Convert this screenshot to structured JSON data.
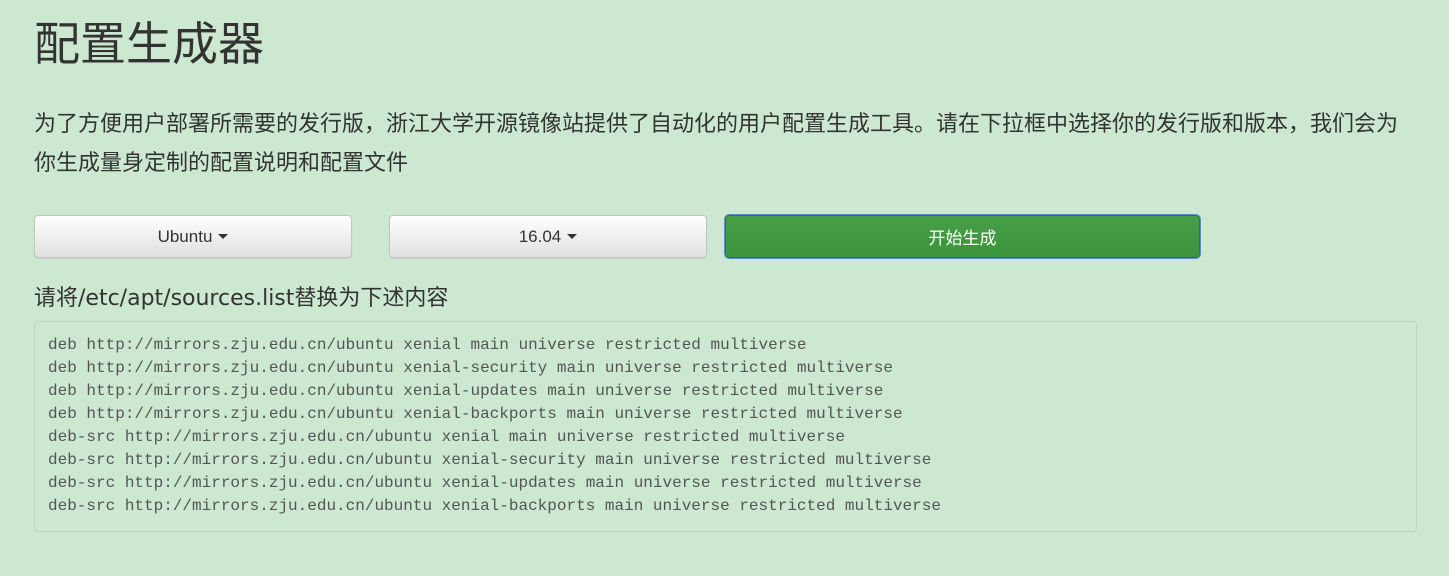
{
  "page": {
    "title": "配置生成器",
    "description": "为了方便用户部署所需要的发行版，浙江大学开源镜像站提供了自动化的用户配置生成工具。请在下拉框中选择你的发行版和版本，我们会为你生成量身定制的配置说明和配置文件"
  },
  "controls": {
    "distro_selected": "Ubuntu",
    "version_selected": "16.04",
    "generate_label": "开始生成"
  },
  "result": {
    "label": "请将/etc/apt/sources.list替换为下述内容",
    "lines": [
      "deb http://mirrors.zju.edu.cn/ubuntu xenial main universe restricted multiverse",
      "deb http://mirrors.zju.edu.cn/ubuntu xenial-security main universe restricted multiverse",
      "deb http://mirrors.zju.edu.cn/ubuntu xenial-updates main universe restricted multiverse",
      "deb http://mirrors.zju.edu.cn/ubuntu xenial-backports main universe restricted multiverse",
      "deb-src http://mirrors.zju.edu.cn/ubuntu xenial main universe restricted multiverse",
      "deb-src http://mirrors.zju.edu.cn/ubuntu xenial-security main universe restricted multiverse",
      "deb-src http://mirrors.zju.edu.cn/ubuntu xenial-updates main universe restricted multiverse",
      "deb-src http://mirrors.zju.edu.cn/ubuntu xenial-backports main universe restricted multiverse"
    ]
  },
  "colors": {
    "background": "#cce8d0",
    "primary_button": "#3f9a3f",
    "text": "#333333"
  }
}
